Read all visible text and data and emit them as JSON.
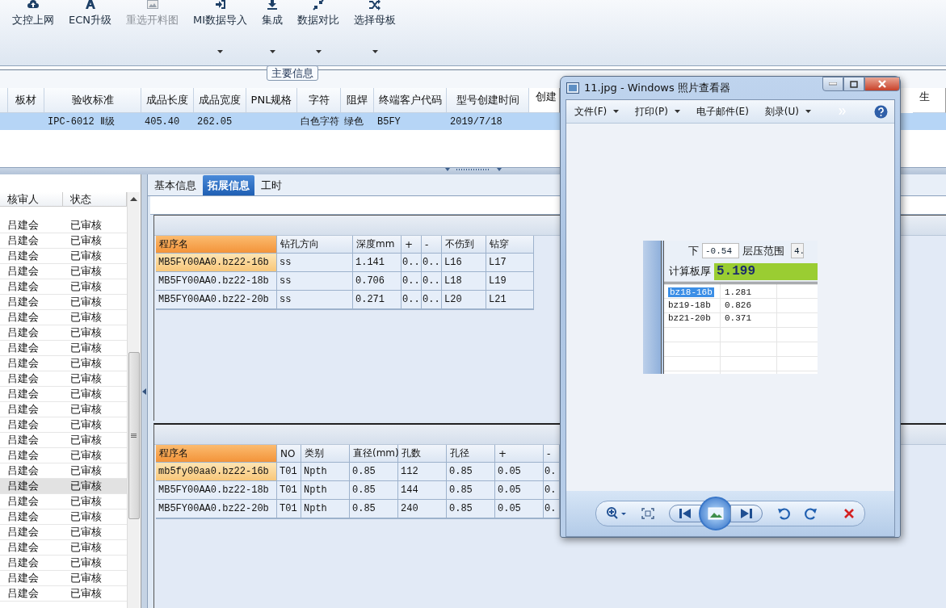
{
  "toolbar": [
    {
      "label": "文控上网",
      "disabled": false,
      "dropdown": false
    },
    {
      "label": "ECN升级",
      "disabled": false,
      "dropdown": false
    },
    {
      "label": "重选开料图",
      "disabled": true,
      "dropdown": false
    },
    {
      "label": "MI数据导入",
      "disabled": false,
      "dropdown": true
    },
    {
      "label": "集成",
      "disabled": false,
      "dropdown": true
    },
    {
      "label": "数据对比",
      "disabled": false,
      "dropdown": true
    },
    {
      "label": "选择母板",
      "disabled": false,
      "dropdown": true
    }
  ],
  "main_info": {
    "legend": "主要信息",
    "row_selected": true,
    "columns": [
      {
        "label": "板材"
      },
      {
        "label": "验收标准",
        "value": "IPC-6012 Ⅱ级"
      },
      {
        "label": "成品长度",
        "value": "405.40"
      },
      {
        "label": "成品宽度",
        "value": "262.05"
      },
      {
        "label": "PNL规格"
      },
      {
        "label": "字符",
        "value": "白色字符"
      },
      {
        "label": "阻焊",
        "value": "绿色"
      },
      {
        "label": "终端客户代码",
        "value": "B5FY"
      },
      {
        "label": "型号创建时间",
        "value": "2019/7/18"
      },
      {
        "label": "创建"
      },
      {
        "label": "生"
      }
    ]
  },
  "review_list": {
    "columns": [
      "核审人",
      "状态"
    ],
    "rows": [
      {
        "reviewer": "吕建会",
        "status": "已审核",
        "selected": false
      },
      {
        "reviewer": "吕建会",
        "status": "已审核",
        "selected": false
      },
      {
        "reviewer": "吕建会",
        "status": "已审核",
        "selected": false
      },
      {
        "reviewer": "吕建会",
        "status": "已审核",
        "selected": false
      },
      {
        "reviewer": "吕建会",
        "status": "已审核",
        "selected": false
      },
      {
        "reviewer": "吕建会",
        "status": "已审核",
        "selected": false
      },
      {
        "reviewer": "吕建会",
        "status": "已审核",
        "selected": false
      },
      {
        "reviewer": "吕建会",
        "status": "已审核",
        "selected": false
      },
      {
        "reviewer": "吕建会",
        "status": "已审核",
        "selected": false
      },
      {
        "reviewer": "吕建会",
        "status": "已审核",
        "selected": false
      },
      {
        "reviewer": "吕建会",
        "status": "已审核",
        "selected": false
      },
      {
        "reviewer": "吕建会",
        "status": "已审核",
        "selected": false
      },
      {
        "reviewer": "吕建会",
        "status": "已审核",
        "selected": false
      },
      {
        "reviewer": "吕建会",
        "status": "已审核",
        "selected": false
      },
      {
        "reviewer": "吕建会",
        "status": "已审核",
        "selected": false
      },
      {
        "reviewer": "吕建会",
        "status": "已审核",
        "selected": false
      },
      {
        "reviewer": "吕建会",
        "status": "已审核",
        "selected": false
      },
      {
        "reviewer": "吕建会",
        "status": "已审核",
        "selected": true
      },
      {
        "reviewer": "吕建会",
        "status": "已审核",
        "selected": false
      },
      {
        "reviewer": "吕建会",
        "status": "已审核",
        "selected": false
      },
      {
        "reviewer": "吕建会",
        "status": "已审核",
        "selected": false
      },
      {
        "reviewer": "吕建会",
        "status": "已审核",
        "selected": false
      },
      {
        "reviewer": "吕建会",
        "status": "已审核",
        "selected": false
      },
      {
        "reviewer": "吕建会",
        "status": "已审核",
        "selected": false
      },
      {
        "reviewer": "吕建会",
        "status": "已审核",
        "selected": false
      }
    ]
  },
  "tabs": [
    {
      "label": "基本信息",
      "selected": false
    },
    {
      "label": "拓展信息",
      "selected": true
    },
    {
      "label": "工时",
      "selected": false
    }
  ],
  "drill_table": {
    "columns": [
      "程序名",
      "钻孔方向",
      "深度mm",
      "+",
      "-",
      "不伤到",
      "钻穿"
    ],
    "rows": [
      {
        "selected": true,
        "cells": [
          "MB5FY00AA0.bz22-16b",
          "ss",
          "1.141",
          "0..",
          "0..",
          "L16",
          "L17"
        ]
      },
      {
        "selected": false,
        "cells": [
          "MB5FY00AA0.bz22-18b",
          "ss",
          "0.706",
          "0..",
          "0..",
          "L18",
          "L19"
        ]
      },
      {
        "selected": false,
        "cells": [
          "MB5FY00AA0.bz22-20b",
          "ss",
          "0.271",
          "0..",
          "0..",
          "L20",
          "L21"
        ]
      }
    ]
  },
  "routing_table": {
    "columns": [
      "程序名",
      "NO",
      "类别",
      "直径(mm)",
      "孔数",
      "孔径",
      "+",
      "-"
    ],
    "rows": [
      {
        "selected": true,
        "cells": [
          "mb5fy00aa0.bz22-16b",
          "T01",
          "Npth",
          "0.85",
          "112",
          "0.85",
          "0.05",
          "0."
        ]
      },
      {
        "selected": false,
        "cells": [
          "MB5FY00AA0.bz22-18b",
          "T01",
          "Npth",
          "0.85",
          "144",
          "0.85",
          "0.05",
          "0."
        ]
      },
      {
        "selected": false,
        "cells": [
          "MB5FY00AA0.bz22-20b",
          "T01",
          "Npth",
          "0.85",
          "240",
          "0.85",
          "0.05",
          "0."
        ]
      }
    ]
  },
  "photo_viewer": {
    "title": "11.jpg - Windows 照片查看器",
    "menu": [
      {
        "label": "文件(F)",
        "dropdown": true
      },
      {
        "label": "打印(P)",
        "dropdown": true
      },
      {
        "label": "电子邮件(E)",
        "dropdown": false
      },
      {
        "label": "刻录(U)",
        "dropdown": true
      }
    ],
    "image": {
      "lower_label": "下",
      "lower_value": "-0.54",
      "range_label": "层压范围",
      "range_value": "4.",
      "thickness_label": "计算板厚",
      "thickness_value": "5.199",
      "rows": [
        {
          "name": "bz18-16b",
          "value": "1.281",
          "selected": true
        },
        {
          "name": "bz19-18b",
          "value": "0.826",
          "selected": false
        },
        {
          "name": "bz21-20b",
          "value": "0.371",
          "selected": false
        }
      ]
    }
  }
}
